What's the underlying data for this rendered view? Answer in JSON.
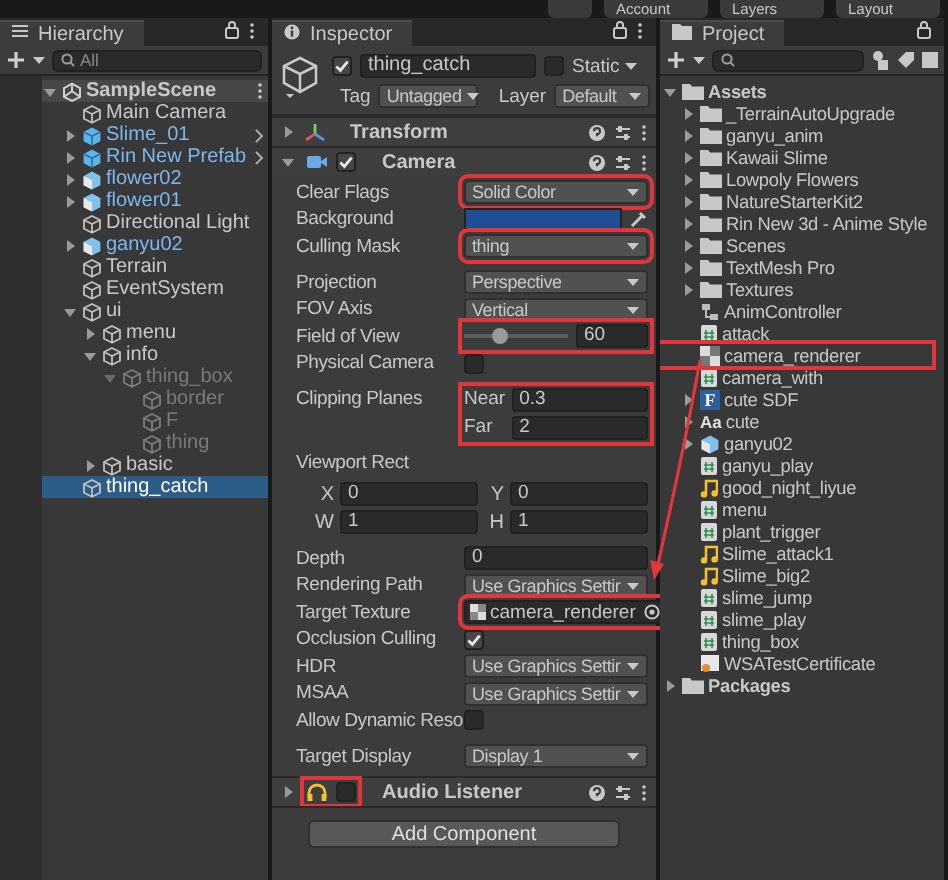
{
  "toolbar": {
    "items": [
      "Account",
      "Layers",
      "Layout"
    ]
  },
  "hierarchy": {
    "title": "Hierarchy",
    "search": {
      "placeholder": "All"
    },
    "items": [
      {
        "label": "SampleScene",
        "kind": "scene",
        "expanded": true,
        "selected": false,
        "disabled": false,
        "children": [
          {
            "label": "Main Camera",
            "kind": "object",
            "selected": false,
            "disabled": false
          },
          {
            "label": "Slime_01",
            "kind": "prefab",
            "expanded": false,
            "selected": false,
            "disabled": false
          },
          {
            "label": "Rin New Prefab",
            "kind": "prefab",
            "expanded": false,
            "selected": false,
            "disabled": false
          },
          {
            "label": "flower02",
            "kind": "model",
            "expanded": false,
            "selected": false,
            "disabled": false
          },
          {
            "label": "flower01",
            "kind": "model",
            "expanded": false,
            "selected": false,
            "disabled": false
          },
          {
            "label": "Directional Light",
            "kind": "object",
            "selected": false,
            "disabled": false
          },
          {
            "label": "ganyu02",
            "kind": "model",
            "expanded": false,
            "selected": false,
            "disabled": false
          },
          {
            "label": "Terrain",
            "kind": "object",
            "selected": false,
            "disabled": false
          },
          {
            "label": "EventSystem",
            "kind": "object",
            "selected": false,
            "disabled": false
          },
          {
            "label": "ui",
            "kind": "object",
            "expanded": true,
            "selected": false,
            "disabled": false,
            "children": [
              {
                "label": "menu",
                "kind": "object",
                "expanded": false,
                "selected": false,
                "disabled": false
              },
              {
                "label": "info",
                "kind": "object",
                "expanded": true,
                "selected": false,
                "disabled": false,
                "children": [
                  {
                    "label": "thing_box",
                    "kind": "object",
                    "expanded": true,
                    "selected": false,
                    "disabled": true,
                    "children": [
                      {
                        "label": "border",
                        "kind": "object",
                        "selected": false,
                        "disabled": true
                      },
                      {
                        "label": "F",
                        "kind": "object",
                        "selected": false,
                        "disabled": true
                      },
                      {
                        "label": "thing",
                        "kind": "object",
                        "selected": false,
                        "disabled": true
                      }
                    ]
                  }
                ]
              },
              {
                "label": "basic",
                "kind": "object",
                "expanded": false,
                "selected": false,
                "disabled": false
              }
            ]
          },
          {
            "label": "thing_catch",
            "kind": "object",
            "selected": true,
            "disabled": false
          }
        ]
      }
    ]
  },
  "inspector": {
    "title": "Inspector",
    "object": {
      "name": "thing_catch",
      "active": true,
      "static_label": "Static",
      "static": false,
      "tag_label": "Tag",
      "tag": "Untagged",
      "layer_label": "Layer",
      "layer": "Default"
    },
    "components": [
      {
        "name": "Transform",
        "kind": "transform",
        "expanded": false
      },
      {
        "name": "Camera",
        "kind": "camera",
        "expanded": true,
        "enabled": true,
        "sections": [
          [
            {
              "label": "Clear Flags",
              "kind": "dropdown",
              "value": "Solid Color",
              "highlighted": true
            },
            {
              "label": "Background",
              "kind": "color",
              "color": "#1f4e92"
            },
            {
              "label": "Culling Mask",
              "kind": "dropdown",
              "value": "thing",
              "highlighted": true
            }
          ],
          [
            {
              "label": "Projection",
              "kind": "dropdown",
              "value": "Perspective"
            },
            {
              "label": "FOV Axis",
              "kind": "dropdown",
              "value": "Vertical"
            },
            {
              "label": "Field of View",
              "kind": "slider",
              "level": 0.35,
              "value": "60",
              "highlighted": true
            },
            {
              "label": "Physical Camera",
              "kind": "checkbox",
              "checked": false
            }
          ],
          [
            {
              "label": "Clipping Planes",
              "kind": "pair",
              "parts": [
                {
                  "label": "Near",
                  "value": "0.3"
                },
                {
                  "label": "Far",
                  "value": "2"
                }
              ],
              "highlighted": true
            }
          ],
          [
            {
              "label": "Viewport Rect",
              "kind": "rect",
              "parts": [
                {
                  "label": "X",
                  "value": "0"
                },
                {
                  "label": "Y",
                  "value": "0"
                },
                {
                  "label": "W",
                  "value": "1"
                },
                {
                  "label": "H",
                  "value": "1"
                }
              ]
            }
          ],
          [
            {
              "label": "Depth",
              "kind": "text",
              "value": "0"
            },
            {
              "label": "Rendering Path",
              "kind": "dropdown",
              "value": "Use Graphics Settir"
            },
            {
              "label": "Target Texture",
              "kind": "object",
              "value": "camera_renderer",
              "highlighted": true
            },
            {
              "label": "Occlusion Culling",
              "kind": "checkbox",
              "checked": true
            },
            {
              "label": "HDR",
              "kind": "dropdown",
              "value": "Use Graphics Settir"
            },
            {
              "label": "MSAA",
              "kind": "dropdown",
              "value": "Use Graphics Settir"
            },
            {
              "label": "Allow Dynamic Reso",
              "kind": "checkbox",
              "checked": false
            }
          ],
          [
            {
              "label": "Target Display",
              "kind": "dropdown",
              "value": "Display 1"
            }
          ]
        ]
      },
      {
        "name": "Audio Listener",
        "kind": "audio",
        "expanded": false,
        "enabled": false,
        "highlighted": true
      }
    ],
    "add_button": "Add Component"
  },
  "project": {
    "title": "Project",
    "items": [
      {
        "label": "Assets",
        "kind": "folder",
        "expanded": true,
        "children": [
          {
            "label": "_TerrainAutoUpgrade",
            "kind": "folder",
            "expanded": false
          },
          {
            "label": "ganyu_anim",
            "kind": "folder",
            "expanded": false
          },
          {
            "label": "Kawaii Slime",
            "kind": "folder",
            "expanded": false
          },
          {
            "label": "Lowpoly Flowers",
            "kind": "folder",
            "expanded": false
          },
          {
            "label": "NatureStarterKit2",
            "kind": "folder",
            "expanded": false
          },
          {
            "label": "Rin New 3d - Anime Style",
            "kind": "folder",
            "expanded": false
          },
          {
            "label": "Scenes",
            "kind": "folder",
            "expanded": false
          },
          {
            "label": "TextMesh Pro",
            "kind": "folder",
            "expanded": false
          },
          {
            "label": "Textures",
            "kind": "folder",
            "expanded": false
          },
          {
            "label": "AnimController",
            "kind": "controller"
          },
          {
            "label": "attack",
            "kind": "script"
          },
          {
            "label": "camera_renderer",
            "kind": "render_texture",
            "highlighted": true
          },
          {
            "label": "camera_with",
            "kind": "script"
          },
          {
            "label": "cute SDF",
            "kind": "font_asset",
            "icon_text": "F",
            "expanded": false
          },
          {
            "label": "cute",
            "kind": "font",
            "icon_text": "Aa",
            "expanded": false
          },
          {
            "label": "ganyu02",
            "kind": "model",
            "expanded": false
          },
          {
            "label": "ganyu_play",
            "kind": "script"
          },
          {
            "label": "good_night_liyue",
            "kind": "audio"
          },
          {
            "label": "menu",
            "kind": "script"
          },
          {
            "label": "plant_trigger",
            "kind": "script"
          },
          {
            "label": "Slime_attack1",
            "kind": "audio"
          },
          {
            "label": "Slime_big2",
            "kind": "audio"
          },
          {
            "label": "slime_jump",
            "kind": "script"
          },
          {
            "label": "slime_play",
            "kind": "script"
          },
          {
            "label": "thing_box",
            "kind": "script"
          },
          {
            "label": "WSATestCertificate",
            "kind": "certificate"
          }
        ]
      },
      {
        "label": "Packages",
        "kind": "folder",
        "expanded": false
      }
    ]
  }
}
